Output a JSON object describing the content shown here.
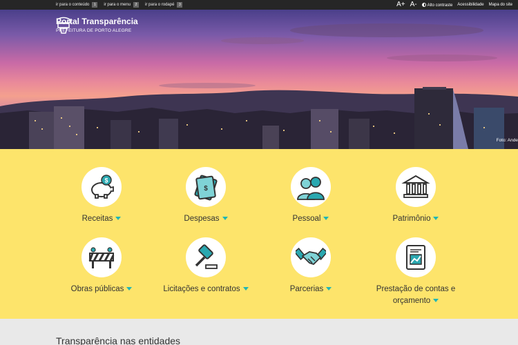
{
  "skip_links": [
    {
      "label": "ir para o conteúdo",
      "key": "1"
    },
    {
      "label": "ir para o menu",
      "key": "2"
    },
    {
      "label": "ir para o rodapé",
      "key": "3"
    }
  ],
  "tools": {
    "font_increase": "A+",
    "font_decrease": "A-",
    "contrast": "Alto contraste",
    "accessibility": "Acessibilidade",
    "sitemap": "Mapa do site"
  },
  "header": {
    "title": "Portal Transparência",
    "subtitle": "PREFEITURA DE PORTO ALEGRE",
    "photo_credit": "Foto: Ande"
  },
  "menu_items": [
    {
      "label": "Receitas",
      "icon": "piggy-bank-icon"
    },
    {
      "label": "Despesas",
      "icon": "money-bills-icon"
    },
    {
      "label": "Pessoal",
      "icon": "people-icon"
    },
    {
      "label": "Patrimônio",
      "icon": "building-icon"
    },
    {
      "label": "Obras públicas",
      "icon": "road-barrier-icon"
    },
    {
      "label": "Licitações e contratos",
      "icon": "gavel-icon"
    },
    {
      "label": "Parcerias",
      "icon": "handshake-icon"
    },
    {
      "label": "Prestação de contas e orçamento",
      "icon": "report-chart-icon"
    }
  ],
  "colors": {
    "accent": "#1fb6b6",
    "menu_bg": "#fde46b",
    "topbar": "#262626"
  },
  "section": {
    "title": "Transparência nas entidades"
  }
}
